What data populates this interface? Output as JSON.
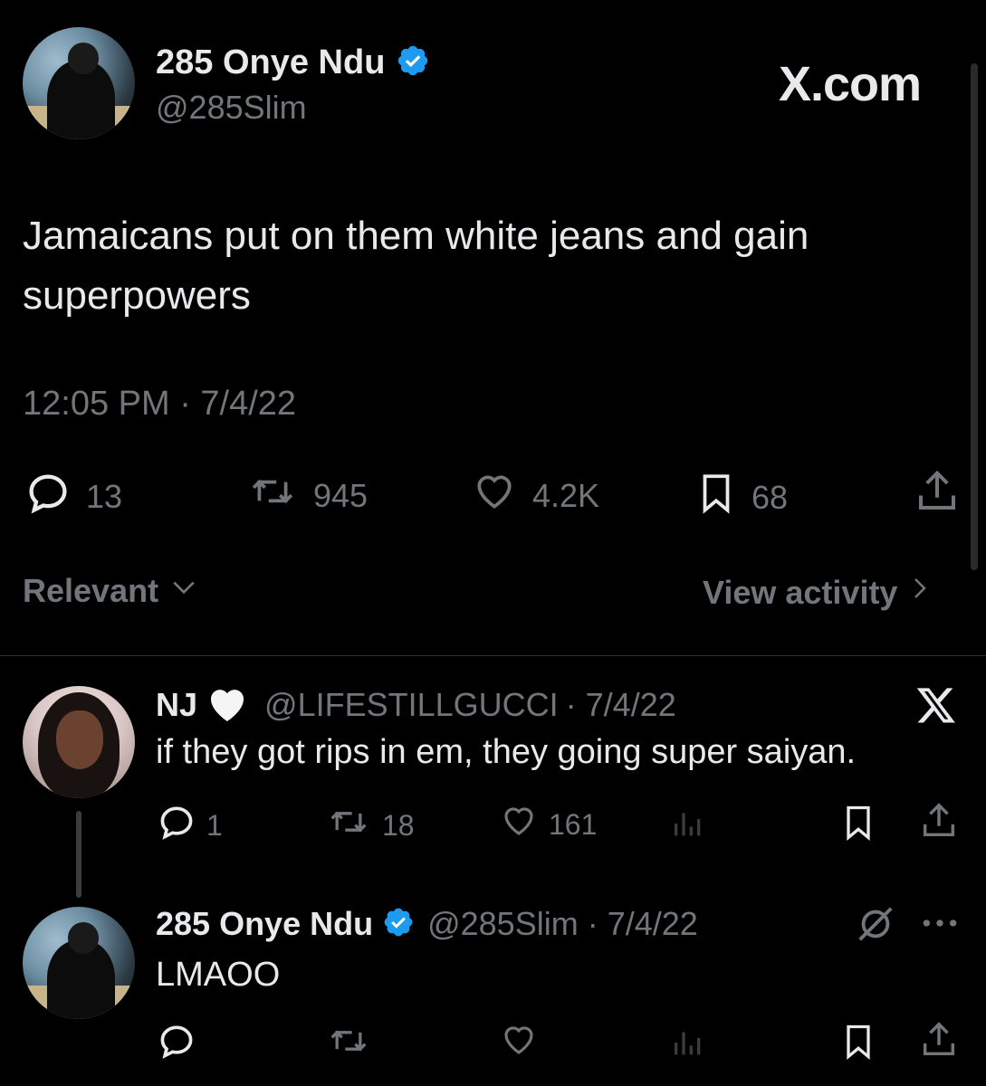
{
  "main_tweet": {
    "author_name": "285 Onye Ndu",
    "handle": "@285Slim",
    "watermark": "X.com",
    "text_line1": "Jamaicans put on them white jeans and gain",
    "text_line2": "superpowers",
    "timestamp": "12:05 PM · 7/4/22",
    "metrics": {
      "replies": "13",
      "retweets": "945",
      "likes": "4.2K",
      "bookmarks": "68"
    }
  },
  "sort_bar": {
    "sort_label": "Relevant",
    "activity_label": "View activity"
  },
  "reply1": {
    "author_name": "NJ",
    "handle": "@LIFESTILLGUCCI",
    "date": "· 7/4/22",
    "text": "if they got rips in em, they going super saiyan.",
    "metrics": {
      "replies": "1",
      "retweets": "18",
      "likes": "161"
    }
  },
  "reply2": {
    "author_name": "285 Onye Ndu",
    "handle": "@285Slim",
    "date": "· 7/4/22",
    "text": "LMAOO"
  },
  "colors": {
    "background": "#000000",
    "text": "#e7e9ea",
    "muted": "#71767b",
    "verified": "#1d9bf0",
    "divider": "#2f3336"
  }
}
